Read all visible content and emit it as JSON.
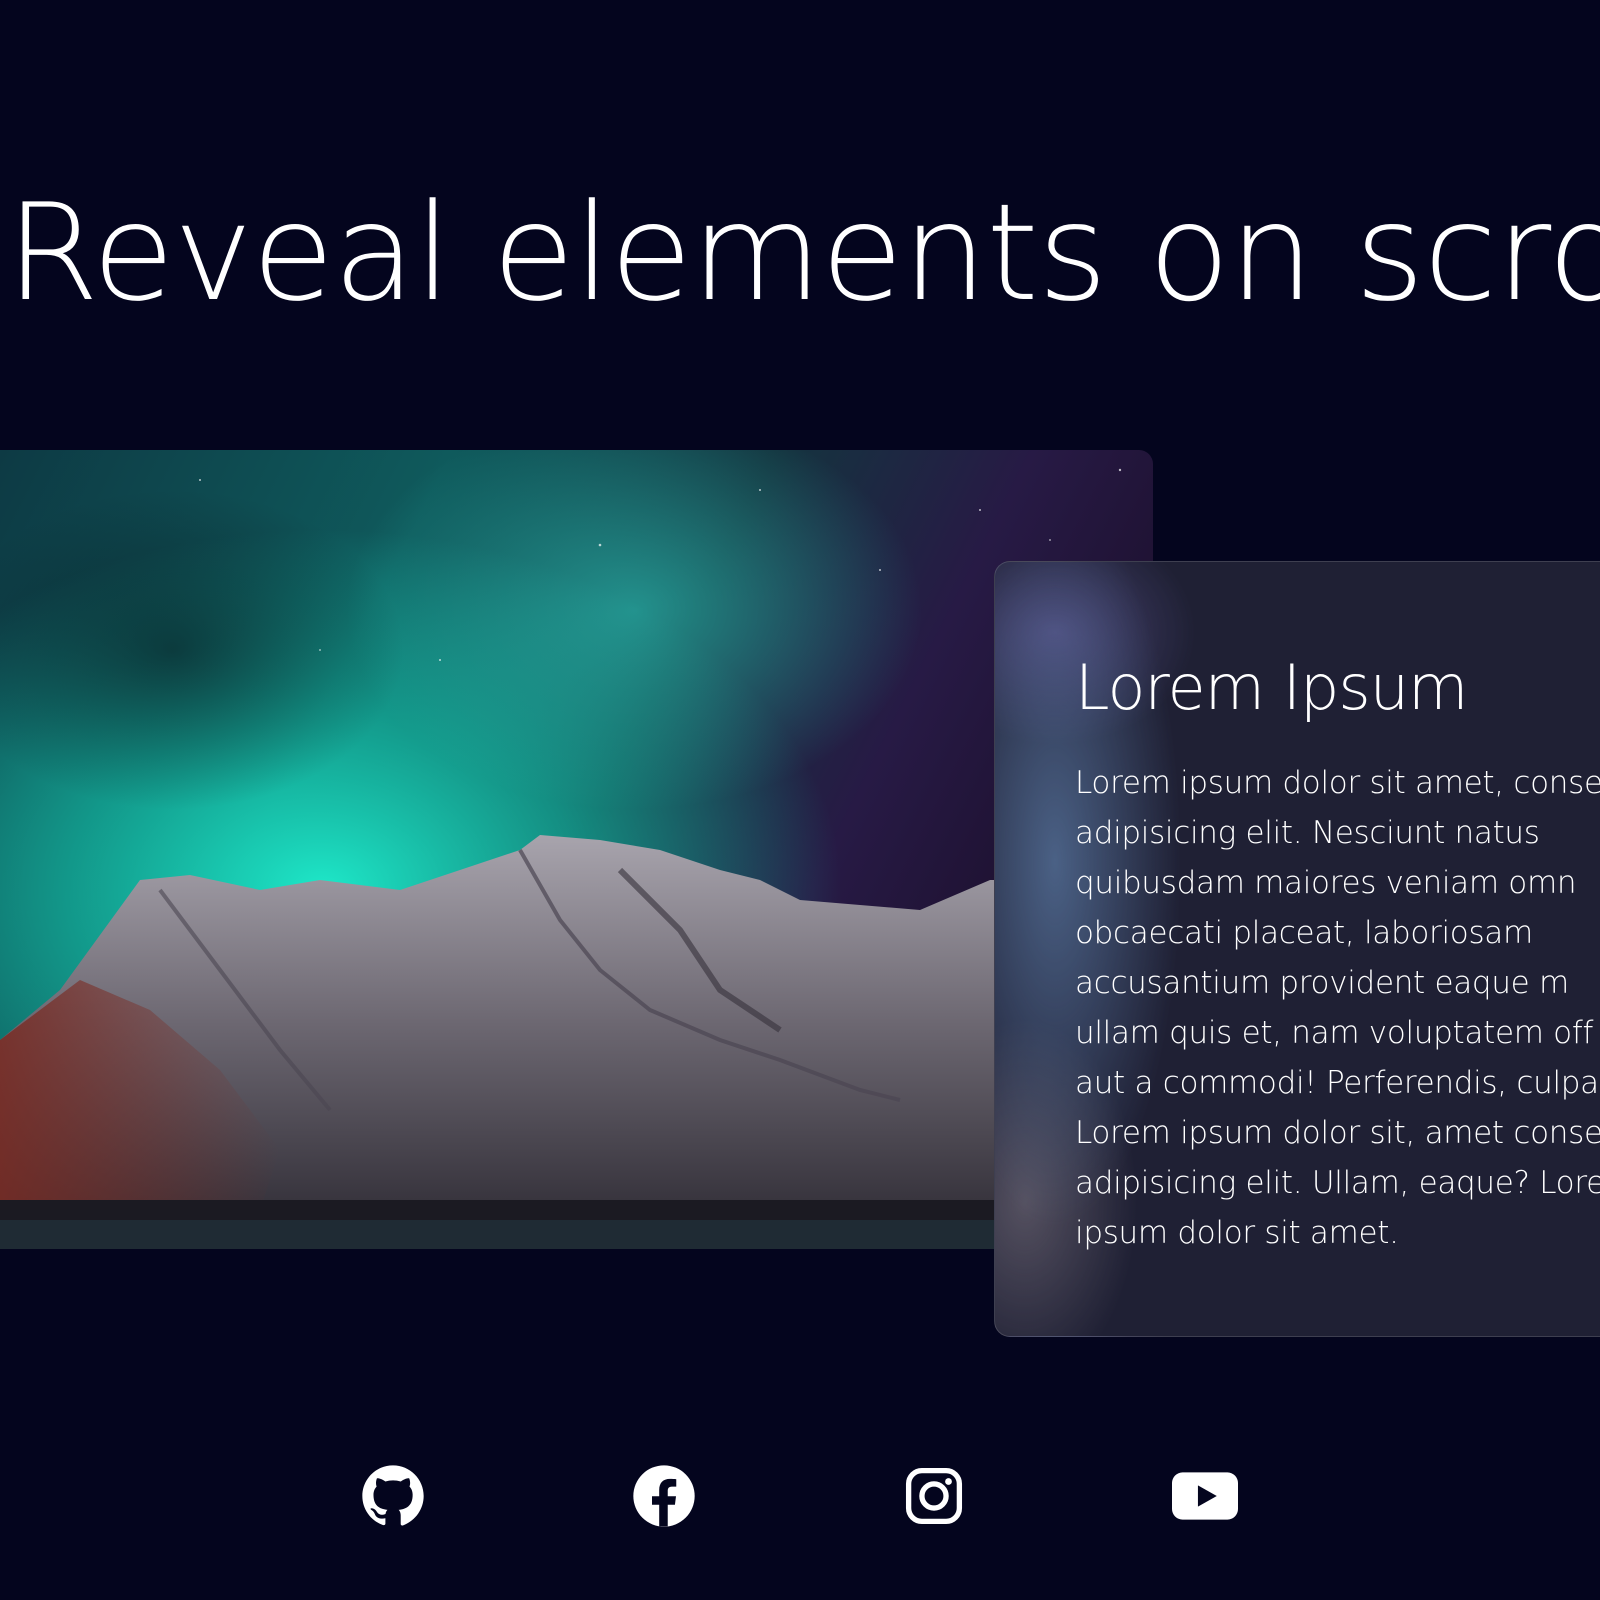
{
  "hero": {
    "title": "Reveal elements on scroll"
  },
  "photo": {
    "description_icon": "aurora-mountain-photo"
  },
  "card": {
    "title": "Lorem Ipsum",
    "body_lines": [
      "Lorem ipsum dolor sit amet, conse",
      "adipisicing elit. Nesciunt natus",
      "quibusdam maiores veniam omn",
      "obcaecati placeat, laboriosam",
      "accusantium provident eaque m",
      "ullam quis et, nam voluptatem off",
      "aut a commodi! Perferendis, culpa",
      "Lorem ipsum dolor sit, amet conse",
      "adipisicing elit. Ullam, eaque? Lore",
      "ipsum dolor sit amet."
    ]
  },
  "social": [
    {
      "icon": "github-icon"
    },
    {
      "icon": "facebook-icon"
    },
    {
      "icon": "instagram-icon"
    },
    {
      "icon": "youtube-icon"
    }
  ],
  "colors": {
    "background": "#04051e",
    "card": "#1f2034",
    "aurora": "#1de0c0",
    "text": "#ffffff"
  }
}
